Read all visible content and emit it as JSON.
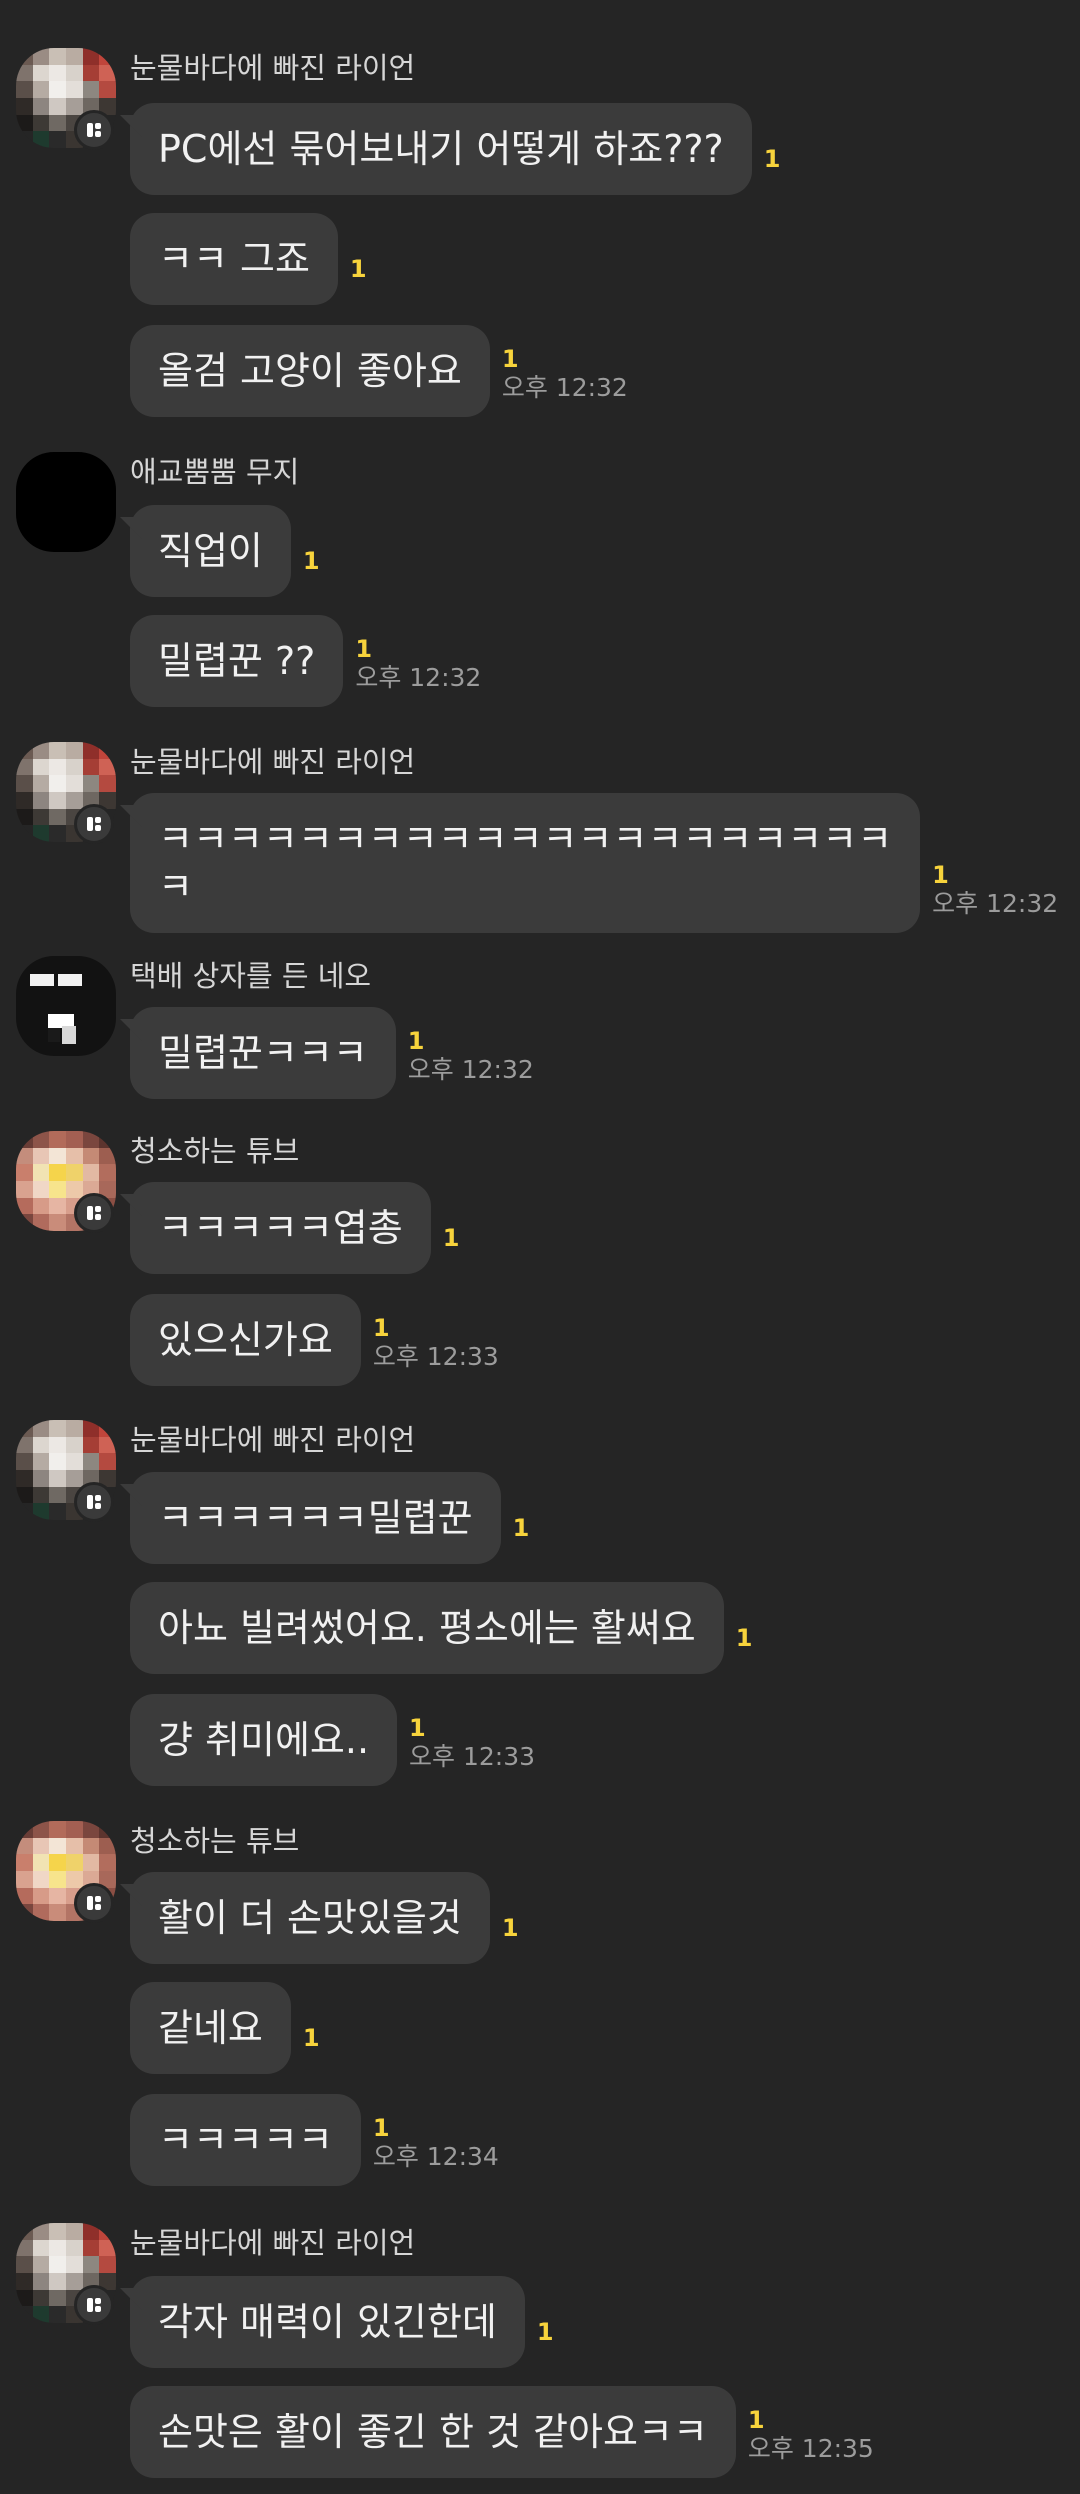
{
  "groups": [
    {
      "sender": "눈물바다에 빠진 라이언",
      "avatar": "lion",
      "messages": [
        {
          "text": "PC에선 묶어보내기 어떻게 하죠???",
          "unread": "1"
        },
        {
          "text": "ㅋㅋ 그죠",
          "unread": "1"
        },
        {
          "text": "올검 고양이 좋아요",
          "unread": "1",
          "time": "오후 12:32"
        }
      ]
    },
    {
      "sender": "애교뿜뿜 무지",
      "avatar": "black",
      "messages": [
        {
          "text": "직업이",
          "unread": "1"
        },
        {
          "text": "밀렵꾼 ??",
          "unread": "1",
          "time": "오후 12:32"
        }
      ]
    },
    {
      "sender": "눈물바다에 빠진 라이언",
      "avatar": "lion",
      "messages": [
        {
          "text": "ㅋㅋㅋㅋㅋㅋㅋㅋㅋㅋㅋㅋㅋㅋㅋㅋㅋㅋㅋㅋㅋ\nㅋ",
          "unread": "1",
          "time": "오후 12:32"
        }
      ]
    },
    {
      "sender": "택배 상자를 든 네오",
      "avatar": "neo",
      "messages": [
        {
          "text": "밀렵꾼ㅋㅋㅋ",
          "unread": "1",
          "time": "오후 12:32"
        }
      ]
    },
    {
      "sender": "청소하는 튜브",
      "avatar": "tube",
      "messages": [
        {
          "text": "ㅋㅋㅋㅋㅋ엽총",
          "unread": "1"
        },
        {
          "text": "있으신가요",
          "unread": "1",
          "time": "오후 12:33"
        }
      ]
    },
    {
      "sender": "눈물바다에 빠진 라이언",
      "avatar": "lion",
      "messages": [
        {
          "text": "ㅋㅋㅋㅋㅋㅋ밀렵꾼",
          "unread": "1"
        },
        {
          "text": "아뇨 빌려썼어요. 평소에는 활써요",
          "unread": "1"
        },
        {
          "text": "걍 취미에요..",
          "unread": "1",
          "time": "오후 12:33"
        }
      ]
    },
    {
      "sender": "청소하는 튜브",
      "avatar": "tube",
      "messages": [
        {
          "text": "활이 더 손맛있을것",
          "unread": "1"
        },
        {
          "text": "같네요",
          "unread": "1"
        },
        {
          "text": "ㅋㅋㅋㅋㅋ",
          "unread": "1",
          "time": "오후 12:34"
        }
      ]
    },
    {
      "sender": "눈물바다에 빠진 라이언",
      "avatar": "lion",
      "messages": [
        {
          "text": "각자 매력이 있긴한데",
          "unread": "1"
        },
        {
          "text": "손맛은 활이 좋긴 한 것 같아요ㅋㅋ",
          "unread": "1",
          "time": "오후 12:35"
        }
      ]
    }
  ]
}
